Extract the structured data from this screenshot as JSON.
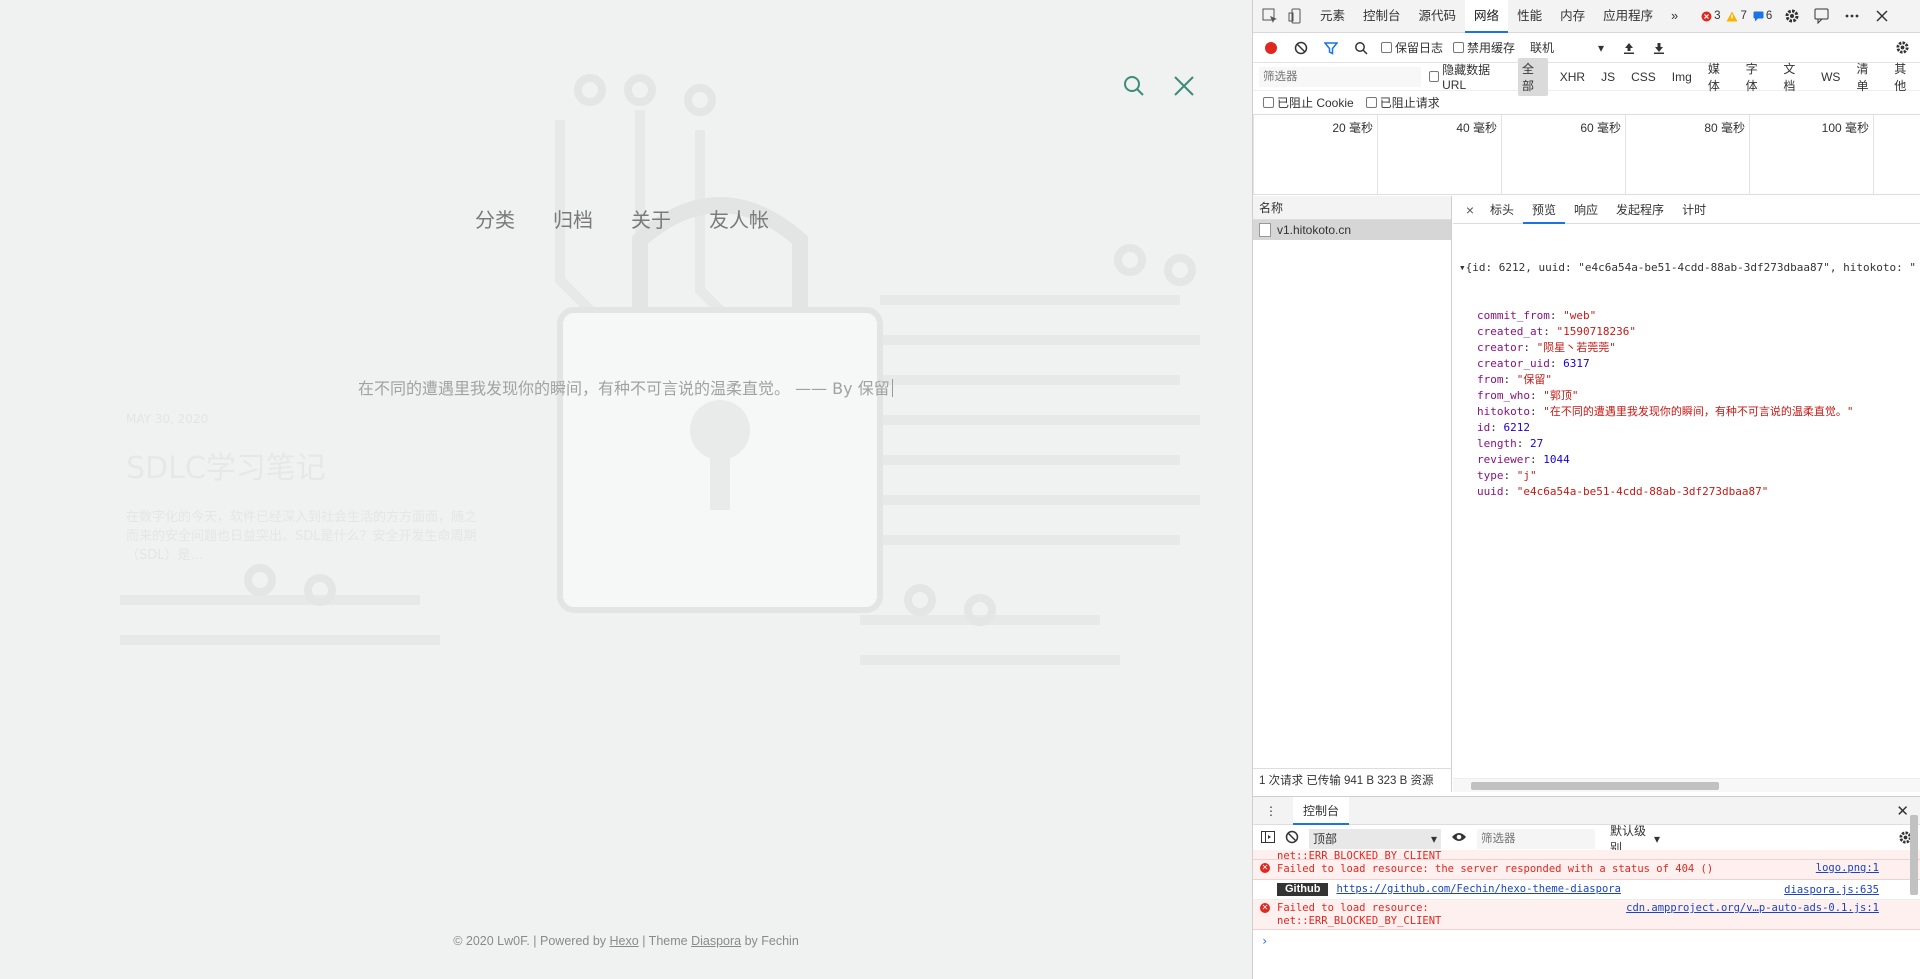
{
  "page": {
    "menu": [
      "分类",
      "归档",
      "关于",
      "友人帐"
    ],
    "quote": "在不同的遭遇里我发现你的瞬间，有种不可言说的温柔直觉。 —— By 保留",
    "post": {
      "date": "MAY 30, 2020",
      "title": "SDLC学习笔记",
      "excerpt": "在数字化的今天，软件已经深入到社会生活的方方面面，随之而来的安全问题也日益突出。SDL是什么？安全开发生命周期（SDL）是..."
    },
    "footer": {
      "prefix": "© 2020 Lw0F. | Powered by",
      "hexo": "Hexo",
      "mid": "| Theme",
      "diaspora": "Diaspora",
      "suffix": "by Fechin"
    }
  },
  "devtools": {
    "tabs": [
      "元素",
      "控制台",
      "源代码",
      "网络",
      "性能",
      "内存",
      "应用程序"
    ],
    "active_tab": "网络",
    "more": "»",
    "errors": "3",
    "warnings": "7",
    "messages": "6",
    "toolbar": {
      "preserve_log": "保留日志",
      "disable_cache": "禁用缓存",
      "throttle": "联机"
    },
    "filter": {
      "placeholder": "筛选器",
      "hide_data_url": "隐藏数据 URL",
      "types": [
        "全部",
        "XHR",
        "JS",
        "CSS",
        "Img",
        "媒体",
        "字体",
        "文档",
        "WS",
        "清单",
        "其他"
      ],
      "blocked_cookies": "已阻止 Cookie",
      "blocked_requests": "已阻止请求"
    },
    "timeline": [
      "20 毫秒",
      "40 毫秒",
      "60 毫秒",
      "80 毫秒",
      "100 毫秒"
    ],
    "names_header": "名称",
    "request_name": "v1.hitokoto.cn",
    "status_bar": "1 次请求  已传输 941 B  323 B 资源",
    "detail_tabs": [
      "标头",
      "预览",
      "响应",
      "发起程序",
      "计时"
    ],
    "active_detail_tab": "预览",
    "preview": {
      "summary": "{id: 6212, uuid: \"e4c6a54a-be51-4cdd-88ab-3df273dbaa87\", hitokoto: \"",
      "fields": [
        {
          "key": "commit_from",
          "value": "\"web\"",
          "kind": "s"
        },
        {
          "key": "created_at",
          "value": "\"1590718236\"",
          "kind": "s"
        },
        {
          "key": "creator",
          "value": "\"陨星丶若莞莞\"",
          "kind": "s"
        },
        {
          "key": "creator_uid",
          "value": "6317",
          "kind": "n"
        },
        {
          "key": "from",
          "value": "\"保留\"",
          "kind": "s"
        },
        {
          "key": "from_who",
          "value": "\"郭顶\"",
          "kind": "s"
        },
        {
          "key": "hitokoto",
          "value": "\"在不同的遭遇里我发现你的瞬间，有种不可言说的温柔直觉。\"",
          "kind": "s"
        },
        {
          "key": "id",
          "value": "6212",
          "kind": "n"
        },
        {
          "key": "length",
          "value": "27",
          "kind": "n"
        },
        {
          "key": "reviewer",
          "value": "1044",
          "kind": "n"
        },
        {
          "key": "type",
          "value": "\"j\"",
          "kind": "s"
        },
        {
          "key": "uuid",
          "value": "\"e4c6a54a-be51-4cdd-88ab-3df273dbaa87\"",
          "kind": "s"
        }
      ]
    },
    "console": {
      "tab": "控制台",
      "context": "顶部",
      "filter_placeholder": "筛选器",
      "level": "默认级别",
      "msg0": "net::ERR_BLOCKED_BY_CLIENT",
      "msg1": "Failed to load resource: the server responded with a status of 404 ()",
      "msg1_src": "logo.png:1",
      "gh_badge": "Github",
      "gh_link": "https://github.com/Fechin/hexo-theme-diaspora",
      "gh_src": "diaspora.js:635",
      "msg3a": "Failed to load resource:",
      "msg3b": "net::ERR_BLOCKED_BY_CLIENT",
      "msg3_src": "cdn.ampproject.org/v…p-auto-ads-0.1.js:1",
      "prompt": "›"
    }
  }
}
